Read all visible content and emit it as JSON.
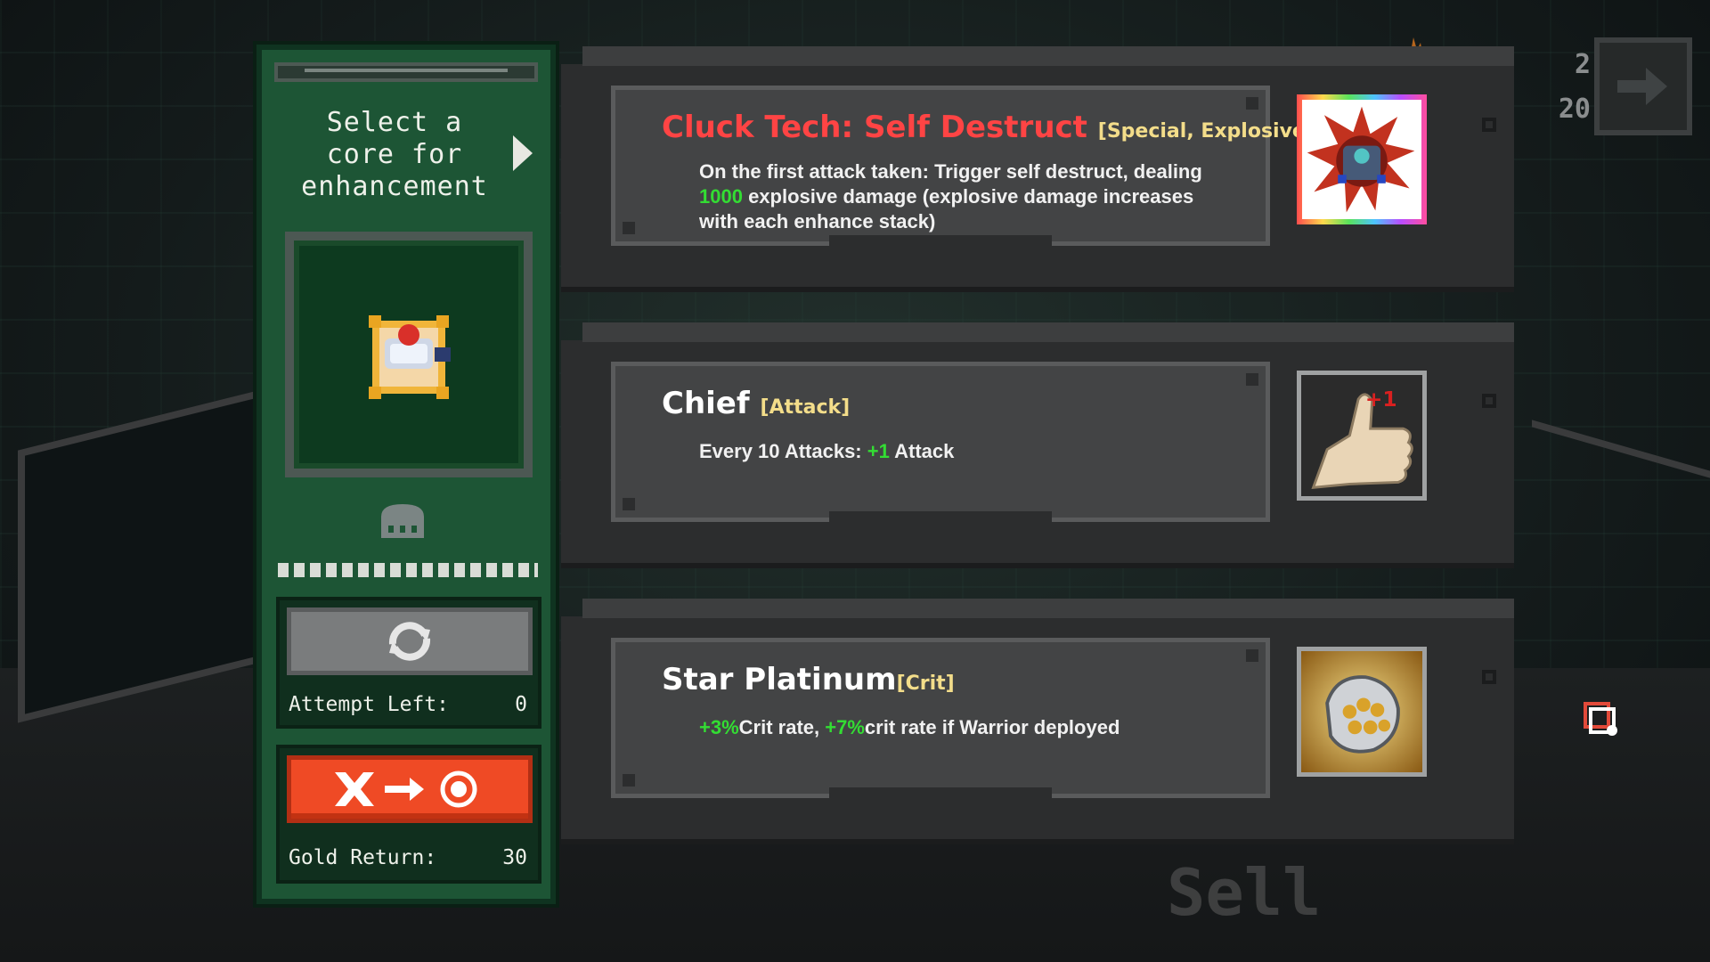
{
  "hud": {
    "counter_top": "2",
    "counter_bottom": "20",
    "sell_watermark": "Sell"
  },
  "side_panel": {
    "title_lines": [
      "Select a",
      "core for",
      "enhancement"
    ],
    "attempt_label": "Attempt Left:",
    "attempt_value": "0",
    "gold_label": "Gold Return:",
    "gold_value": "30"
  },
  "options": [
    {
      "name": "Cluck Tech: Self Destruct",
      "name_color": "#ff4444",
      "tags": "[Special, Explosive]",
      "desc_parts": [
        {
          "text": "On the first attack taken: Trigger self destruct, dealing "
        },
        {
          "text": "1000",
          "highlight": true
        },
        {
          "text": " explosive damage (explosive damage increases with each enhance stack)"
        }
      ],
      "art_icon": "explosion-core-icon",
      "art_border": "rainbow"
    },
    {
      "name": "Chief",
      "name_color": "#ffffff",
      "tags": "[Attack]",
      "desc_parts": [
        {
          "text": "Every 10 Attacks: "
        },
        {
          "text": "+1",
          "highlight": true
        },
        {
          "text": " Attack"
        }
      ],
      "art_icon": "thumbs-up-icon",
      "art_badge": "+1",
      "art_border": "silver"
    },
    {
      "name": "Star Platinum",
      "name_color": "#ffffff",
      "tags": "[Crit]",
      "desc_parts": [
        {
          "text": "+3%",
          "highlight": true
        },
        {
          "text": "Crit rate, "
        },
        {
          "text": "+7%",
          "highlight": true
        },
        {
          "text": "crit rate if Warrior deployed"
        }
      ],
      "art_icon": "platinum-fist-icon",
      "art_border": "silver"
    }
  ],
  "colors": {
    "panel_green": "#1d5535",
    "highlight_green": "#33dd33",
    "tag_gold": "#f3dd8a",
    "sell_red": "#ef4a25"
  }
}
